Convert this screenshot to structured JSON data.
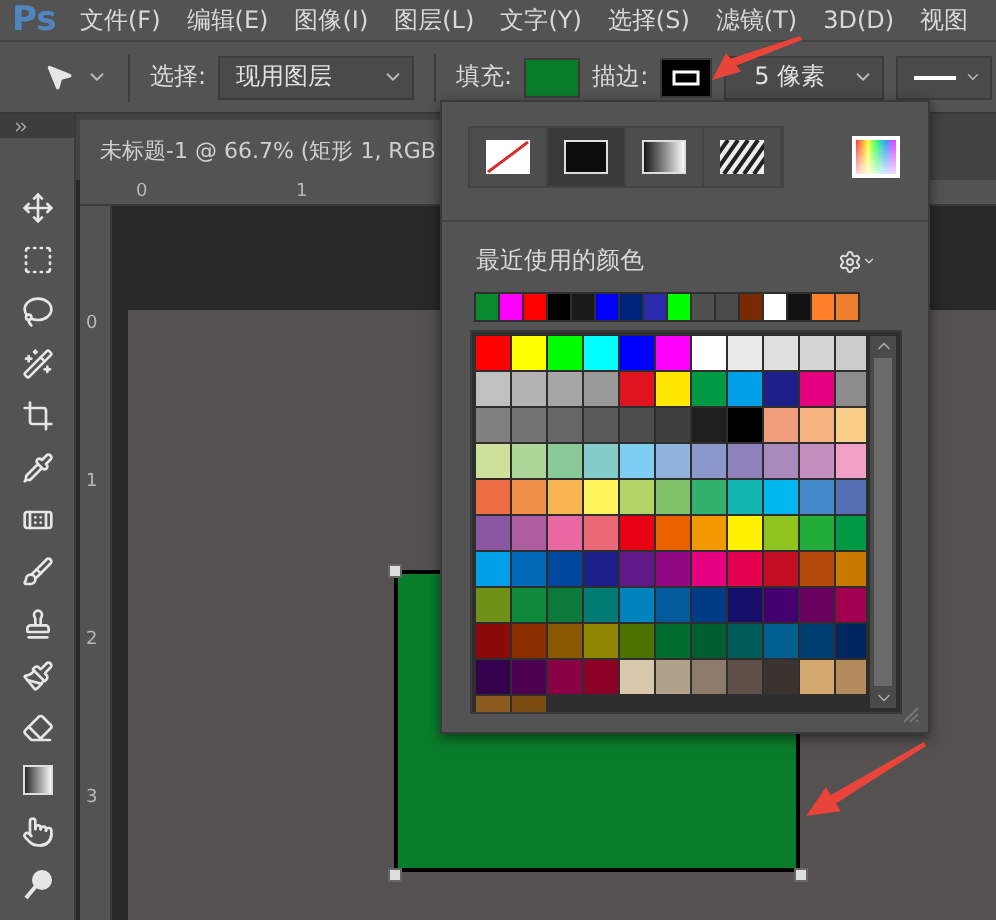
{
  "app_logo": "Ps",
  "menu": [
    {
      "label": "文件(F)"
    },
    {
      "label": "编辑(E)"
    },
    {
      "label": "图像(I)"
    },
    {
      "label": "图层(L)"
    },
    {
      "label": "文字(Y)"
    },
    {
      "label": "选择(S)"
    },
    {
      "label": "滤镜(T)"
    },
    {
      "label": "3D(D)"
    },
    {
      "label": "视图"
    }
  ],
  "options_bar": {
    "select_label": "选择:",
    "select_value": "现用图层",
    "fill_label": "填充:",
    "stroke_label": "描边:",
    "stroke_width": "5 像素"
  },
  "document_tab": {
    "title": "未标题-1 @ 66.7% (矩形 1, RGB"
  },
  "rulers": {
    "horizontal": [
      "0",
      "1"
    ],
    "vertical": [
      "0",
      "1",
      "2",
      "3"
    ]
  },
  "popup": {
    "fill_types": [
      {
        "kind": "none",
        "selected": false
      },
      {
        "kind": "solid",
        "selected": true
      },
      {
        "kind": "gradient",
        "selected": false
      },
      {
        "kind": "pattern",
        "selected": false
      }
    ],
    "recent_label": "最近使用的颜色",
    "recent_colors": [
      {
        "color": "#0a8a2e"
      },
      {
        "color": "#ff00ff"
      },
      {
        "color": "#ff0000"
      },
      {
        "color": "#000000"
      },
      {
        "color": "#1a1a1a"
      },
      {
        "color": "#0000ff"
      },
      {
        "color": "#00237a"
      },
      {
        "color": "#2b2bb0"
      },
      {
        "color": "#00ff00"
      },
      {
        "color": "#505050"
      },
      {
        "color": "#4a4a4a"
      },
      {
        "color": "#7a2a00"
      },
      {
        "color": "#ffffff"
      },
      {
        "color": "#111111"
      },
      {
        "color": "#ff7f2a"
      },
      {
        "color": "#f07f30"
      }
    ],
    "swatches": [
      {
        "color": "#ff0000"
      },
      {
        "color": "#ffff00"
      },
      {
        "color": "#00ff00"
      },
      {
        "color": "#00ffff"
      },
      {
        "color": "#0000ff"
      },
      {
        "color": "#ff00ff"
      },
      {
        "color": "#ffffff"
      },
      {
        "color": "#ebebeb"
      },
      {
        "color": "#e0e0e0"
      },
      {
        "color": "#d6d6d6"
      },
      {
        "color": "#cccccc"
      },
      {
        "color": "#c0c0c0"
      },
      {
        "color": "#b3b3b3"
      },
      {
        "color": "#a6a6a6"
      },
      {
        "color": "#999999"
      },
      {
        "color": "#e0141e"
      },
      {
        "color": "#ffe600"
      },
      {
        "color": "#009944"
      },
      {
        "color": "#00a0e9"
      },
      {
        "color": "#1d2088"
      },
      {
        "color": "#e4007f"
      },
      {
        "color": "#8c8c8c"
      },
      {
        "color": "#808080"
      },
      {
        "color": "#737373"
      },
      {
        "color": "#666666"
      },
      {
        "color": "#595959"
      },
      {
        "color": "#4d4d4d"
      },
      {
        "color": "#404040"
      },
      {
        "color": "#1f1f1f"
      },
      {
        "color": "#000000"
      },
      {
        "color": "#f19e7c"
      },
      {
        "color": "#f6b37f"
      },
      {
        "color": "#facd89"
      },
      {
        "color": "#cde19b"
      },
      {
        "color": "#acd598"
      },
      {
        "color": "#89c997"
      },
      {
        "color": "#84ccc9"
      },
      {
        "color": "#7ecef4"
      },
      {
        "color": "#8fb3dc"
      },
      {
        "color": "#8c97cb"
      },
      {
        "color": "#8f82bc"
      },
      {
        "color": "#aa89bd"
      },
      {
        "color": "#c490bf"
      },
      {
        "color": "#f29fc5"
      },
      {
        "color": "#ef6d45"
      },
      {
        "color": "#f19149"
      },
      {
        "color": "#f8b551"
      },
      {
        "color": "#fff45c"
      },
      {
        "color": "#b3d465"
      },
      {
        "color": "#80c269"
      },
      {
        "color": "#32b16c"
      },
      {
        "color": "#13b5b1"
      },
      {
        "color": "#00b7ee"
      },
      {
        "color": "#448aca"
      },
      {
        "color": "#556fb5"
      },
      {
        "color": "#8957a1"
      },
      {
        "color": "#ae5da1"
      },
      {
        "color": "#ea68a2"
      },
      {
        "color": "#eb6877"
      },
      {
        "color": "#e60012"
      },
      {
        "color": "#eb6100"
      },
      {
        "color": "#f39800"
      },
      {
        "color": "#fff100"
      },
      {
        "color": "#8fc31f"
      },
      {
        "color": "#22ac38"
      },
      {
        "color": "#009944"
      },
      {
        "color": "#00a0e9"
      },
      {
        "color": "#0068b7"
      },
      {
        "color": "#00479d"
      },
      {
        "color": "#1d2088"
      },
      {
        "color": "#601986"
      },
      {
        "color": "#920783"
      },
      {
        "color": "#e4007f"
      },
      {
        "color": "#e5004f"
      },
      {
        "color": "#c30d23"
      },
      {
        "color": "#b5490c"
      },
      {
        "color": "#ca7900"
      },
      {
        "color": "#6f8f17"
      },
      {
        "color": "#0e8a3c"
      },
      {
        "color": "#0c7a3a"
      },
      {
        "color": "#007a73"
      },
      {
        "color": "#0083bd"
      },
      {
        "color": "#005a9b"
      },
      {
        "color": "#003b87"
      },
      {
        "color": "#150f6b"
      },
      {
        "color": "#43006e"
      },
      {
        "color": "#6a005f"
      },
      {
        "color": "#a0004f"
      },
      {
        "color": "#8a0a0a"
      },
      {
        "color": "#8a2f00"
      },
      {
        "color": "#8a5800"
      },
      {
        "color": "#8f8600"
      },
      {
        "color": "#4e7200"
      },
      {
        "color": "#006c2d"
      },
      {
        "color": "#005e30"
      },
      {
        "color": "#005e5a"
      },
      {
        "color": "#005f8f"
      },
      {
        "color": "#003f72"
      },
      {
        "color": "#00265f"
      },
      {
        "color": "#36004f"
      },
      {
        "color": "#4e0050"
      },
      {
        "color": "#8a0045"
      },
      {
        "color": "#8c0028"
      },
      {
        "color": "#d9c8ac"
      },
      {
        "color": "#b0a18a"
      },
      {
        "color": "#8c7b6a"
      },
      {
        "color": "#5e5048"
      },
      {
        "color": "#3a3330"
      },
      {
        "color": "#d3a96f"
      },
      {
        "color": "#b38b5d"
      },
      {
        "color": "#8a5a1f"
      },
      {
        "color": "#7a4a0e"
      }
    ]
  }
}
